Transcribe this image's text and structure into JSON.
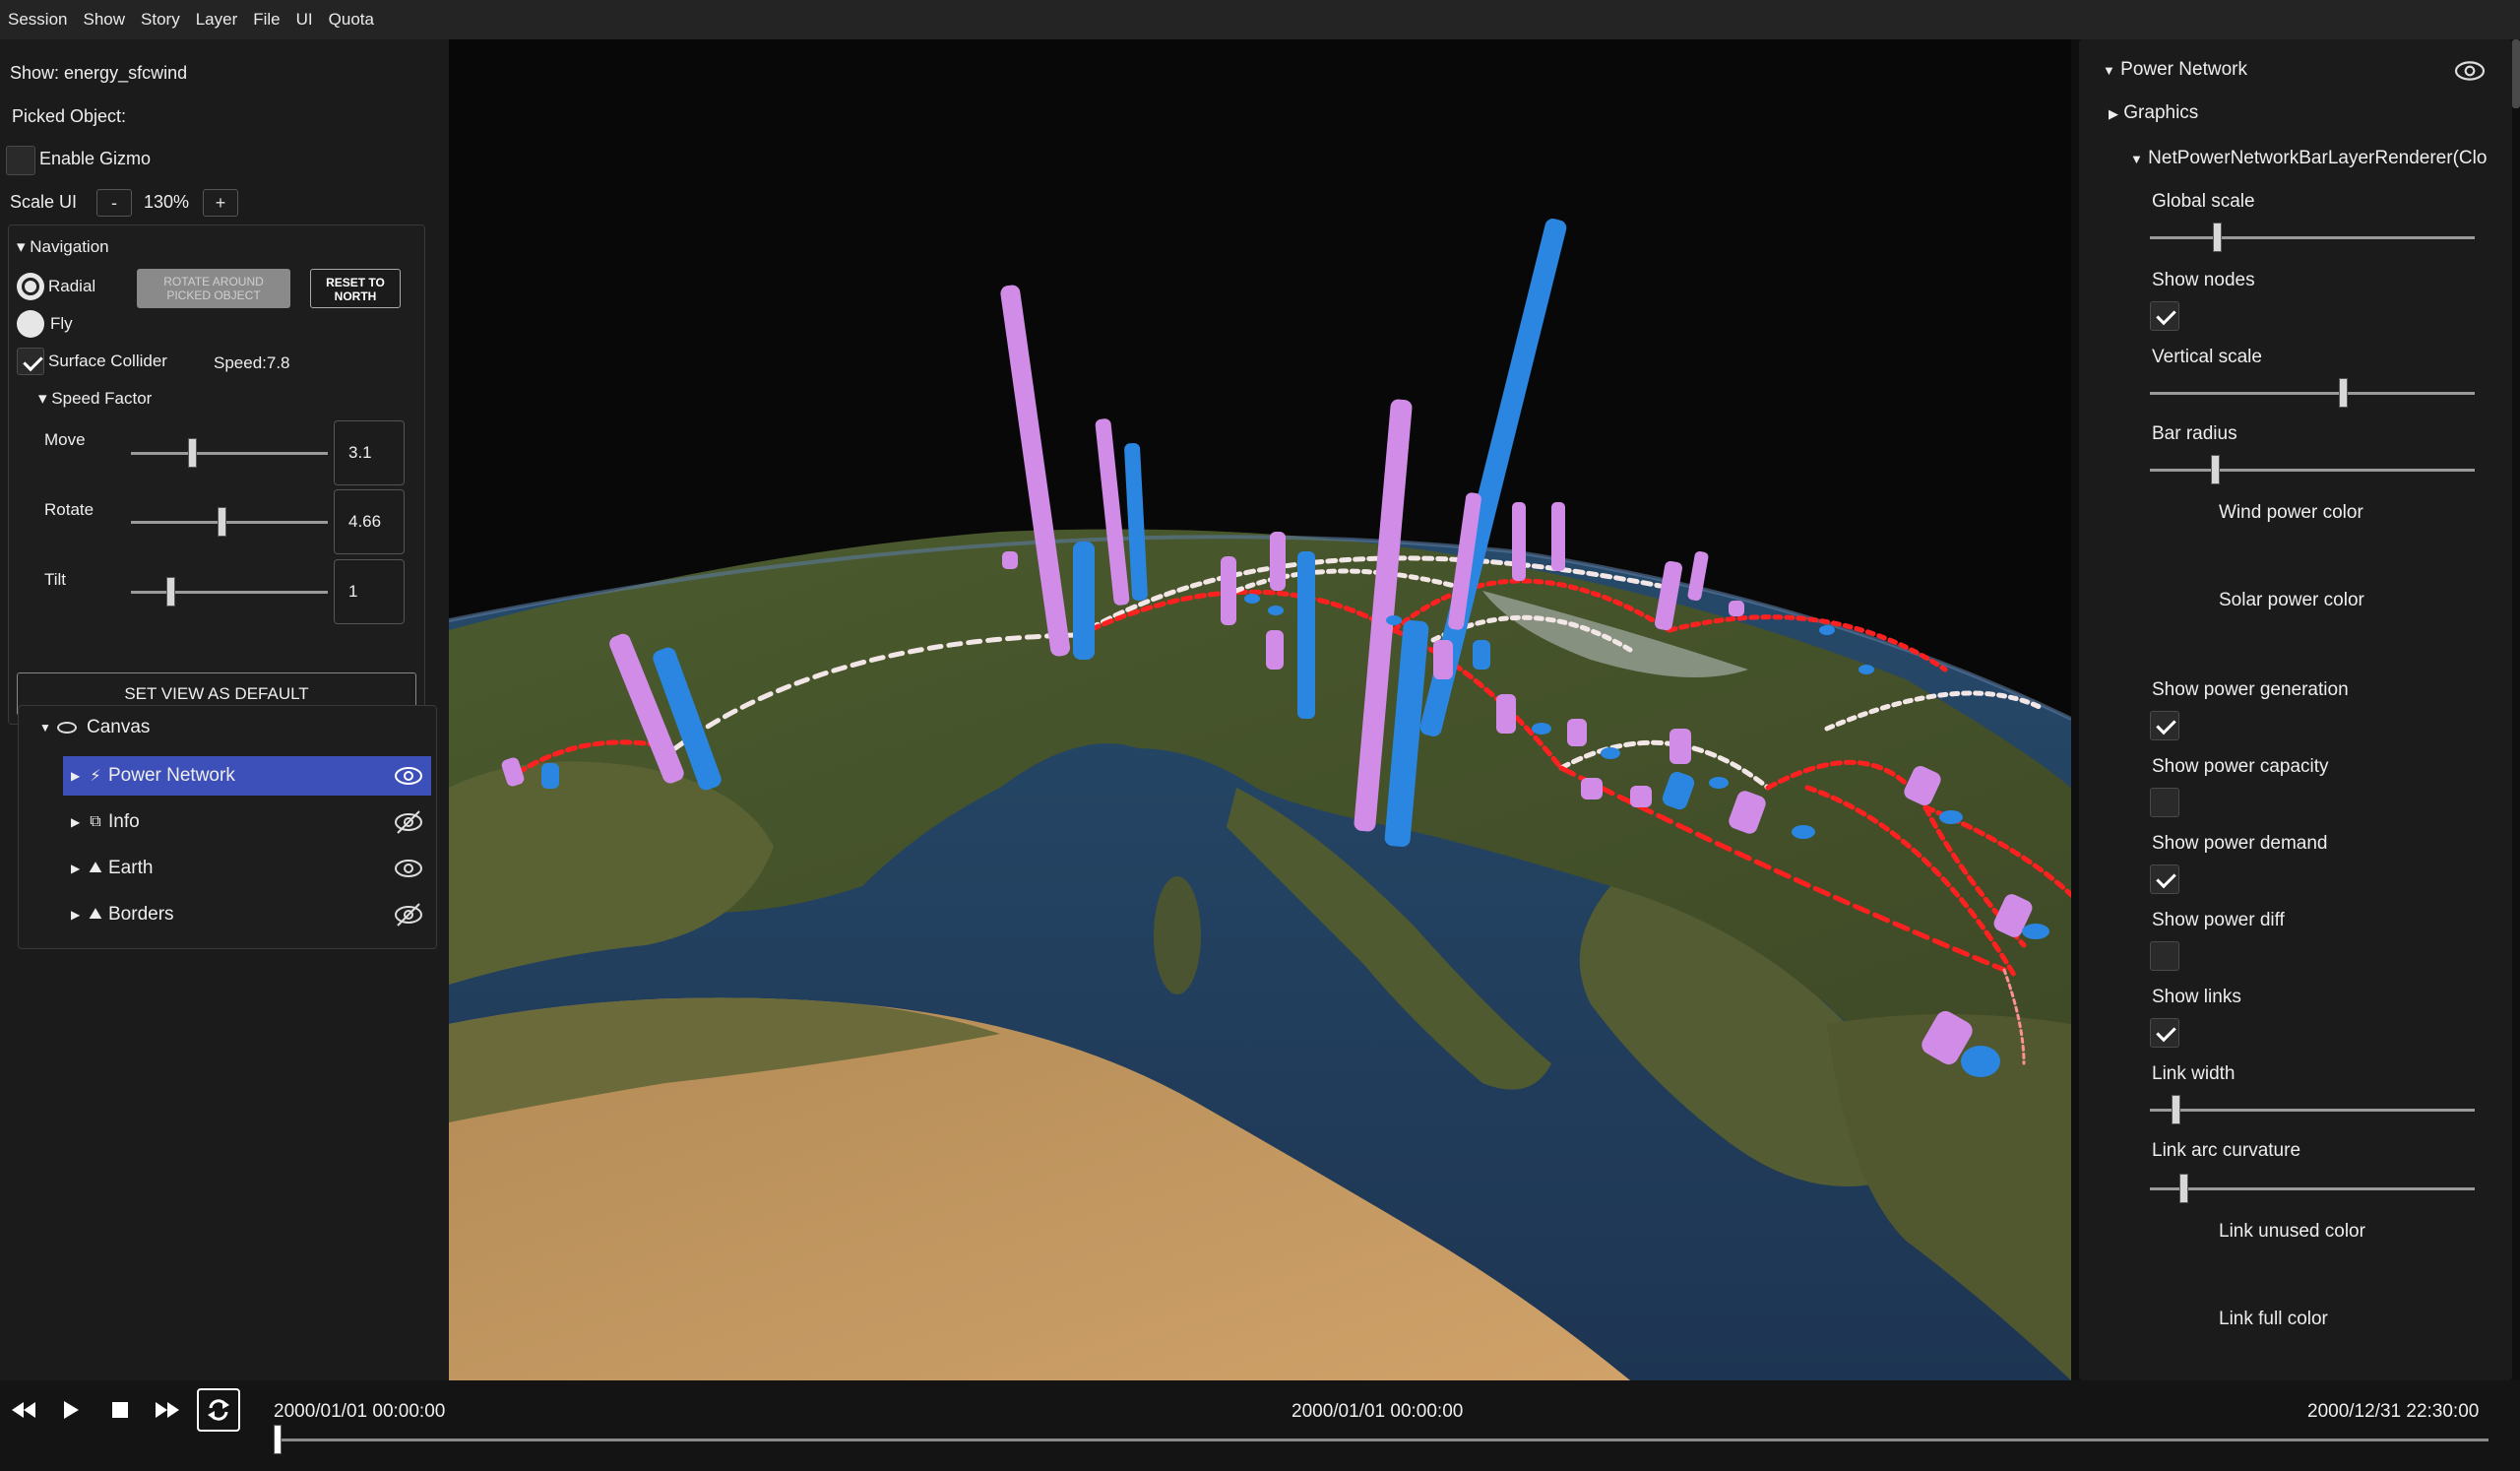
{
  "menu": [
    "Session",
    "Show",
    "Story",
    "Layer",
    "File",
    "UI",
    "Quota"
  ],
  "left": {
    "show_label": "Show: energy_sfcwind",
    "picked_label": "Picked Object:",
    "gizmo_label": "Enable Gizmo",
    "scale_label": "Scale UI",
    "scale_minus": "-",
    "scale_value": "130%",
    "scale_plus": "+",
    "nav_header": "Navigation",
    "radial_label": "Radial",
    "fly_label": "Fly",
    "rotate_picked_line1": "ROTATE AROUND",
    "rotate_picked_line2": "PICKED OBJECT",
    "reset_north_line1": "RESET TO",
    "reset_north_line2": "NORTH",
    "surface_collider_label": "Surface Collider",
    "speed_label": "Speed:7.8",
    "speed_factor_header": "Speed Factor",
    "move_label": "Move",
    "move_value": "3.1",
    "rotate_label": "Rotate",
    "rotate_value": "4.66",
    "tilt_label": "Tilt",
    "tilt_value": "1",
    "set_default_label": "SET VIEW AS DEFAULT",
    "tree_root": "Canvas",
    "tree_items": [
      {
        "label": "Power Network",
        "icon": "bolt-icon",
        "visible": true
      },
      {
        "label": "Info",
        "icon": "cube-icon",
        "visible": false
      },
      {
        "label": "Earth",
        "icon": "mountain-icon",
        "visible": true
      },
      {
        "label": "Borders",
        "icon": "mountain-icon",
        "visible": false
      }
    ]
  },
  "right": {
    "header": "Power Network",
    "graphics": "Graphics",
    "renderer": "NetPowerNetworkBarLayerRenderer(Clo",
    "global_scale": "Global scale",
    "show_nodes": "Show nodes",
    "vertical_scale": "Vertical scale",
    "bar_radius": "Bar radius",
    "wind_color": "Wind power color",
    "solar_color": "Solar power color",
    "show_generation": "Show power generation",
    "show_capacity": "Show power capacity",
    "show_demand": "Show power demand",
    "show_diff": "Show power diff",
    "show_links": "Show links",
    "link_width": "Link width",
    "link_arc": "Link arc curvature",
    "link_unused": "Link unused color",
    "link_full": "Link full color"
  },
  "timeline": {
    "start": "2000/01/01 00:00:00",
    "current": "2000/01/01 00:00:00",
    "end": "2000/12/31 22:30:00"
  },
  "colors": {
    "wind": "#d08ce6",
    "solar": "#2a86e0",
    "link_full": "#ff2020",
    "link_unused": "#ffffff",
    "selection": "#3d4fb8"
  }
}
